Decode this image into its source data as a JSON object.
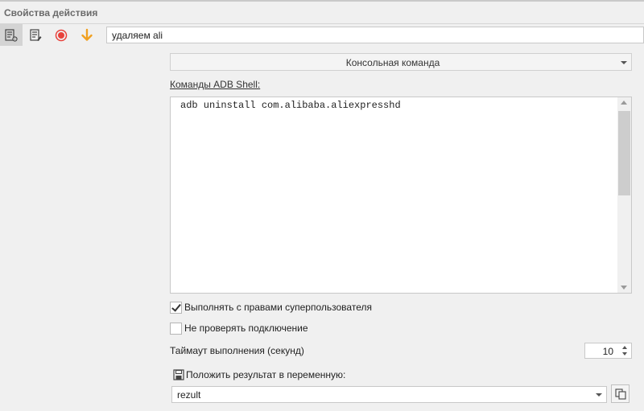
{
  "panel": {
    "title": "Свойства действия"
  },
  "toolbar": {
    "icons": [
      "action-settings-icon",
      "notes-edit-icon",
      "record-icon",
      "arrow-down-icon"
    ],
    "name_value": "удаляем ali"
  },
  "action": {
    "type_selected": "Консольная команда"
  },
  "commands": {
    "label": "Команды ADB Shell:",
    "text": "adb uninstall com.alibaba.aliexpresshd"
  },
  "options": {
    "superuser_label": "Выполнять с правами суперпользователя",
    "superuser_checked": true,
    "no_check_connection_label": "Не проверять подключение",
    "no_check_connection_checked": false
  },
  "timeout": {
    "label": "Таймаут выполнения (секунд)",
    "value": "10"
  },
  "result": {
    "label": "Положить результат в переменную:",
    "variable": "rezult"
  },
  "colors": {
    "record_red": "#e8413b",
    "arrow_orange": "#f0a020",
    "background": "#f0f0f0"
  }
}
